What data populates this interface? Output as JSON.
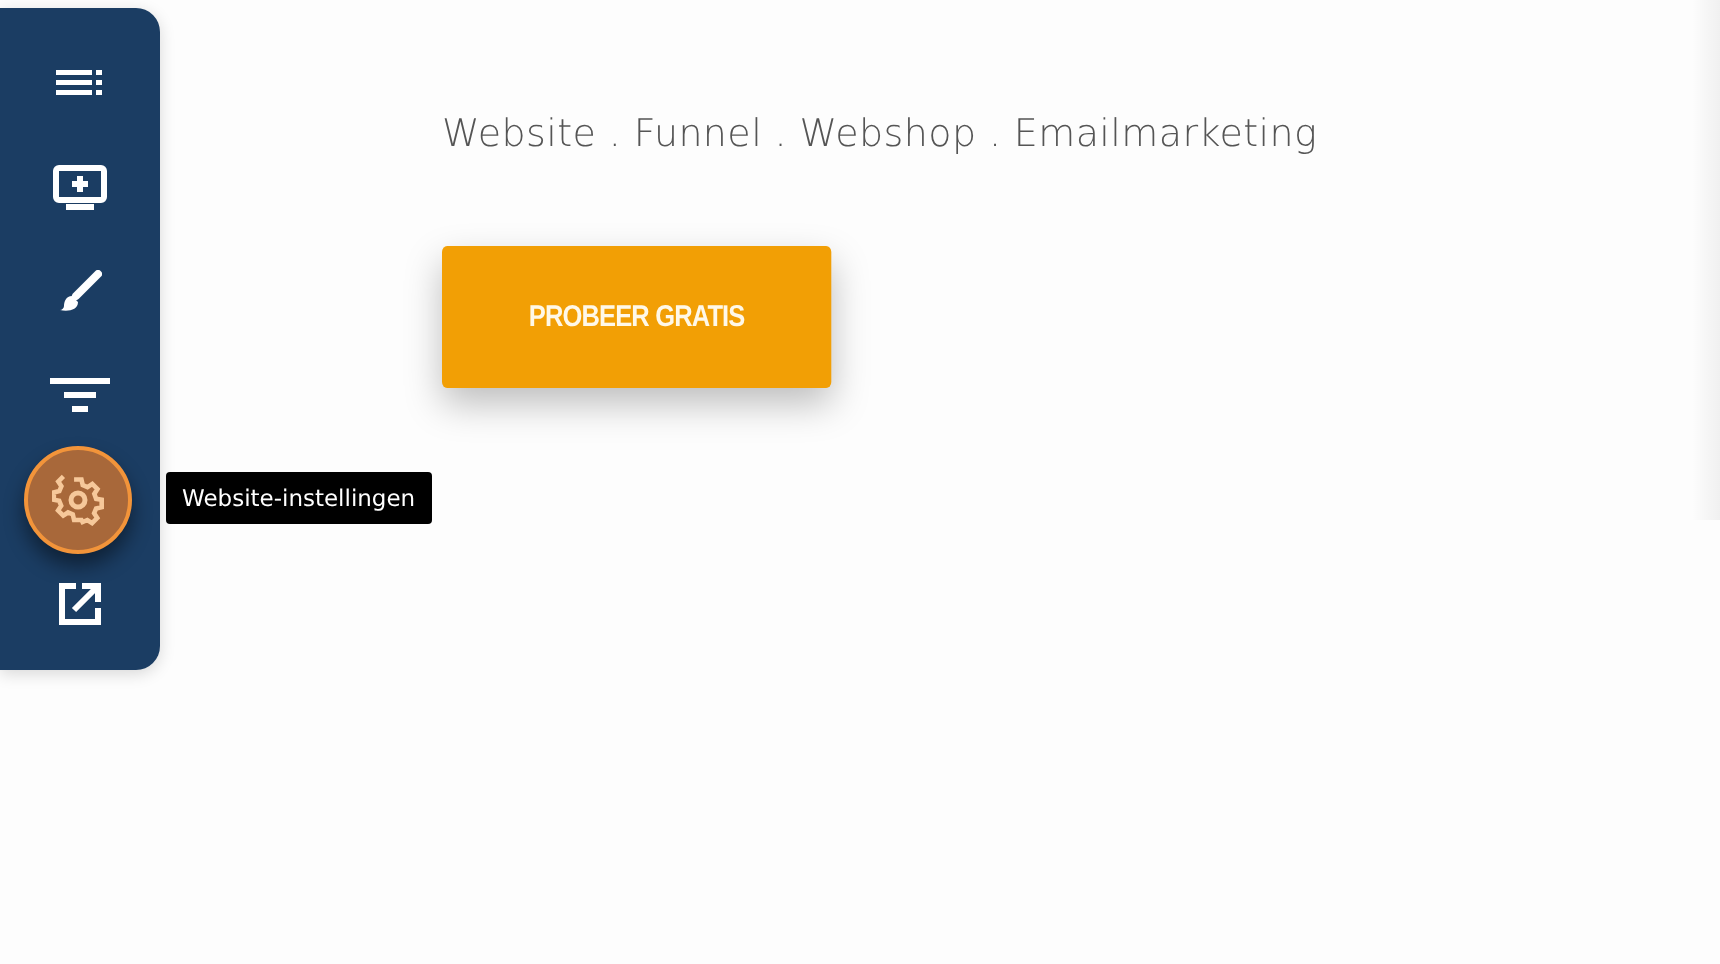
{
  "sidebar": {
    "items": [
      {
        "kind": "list",
        "selected": false
      },
      {
        "kind": "add-screen",
        "selected": false
      },
      {
        "kind": "brush",
        "selected": false
      },
      {
        "kind": "filter",
        "selected": false
      },
      {
        "kind": "gear",
        "selected": true
      },
      {
        "kind": "external",
        "selected": false
      }
    ],
    "tooltip": "Website-instellingen"
  },
  "hero": {
    "subtitle": "Website . Funnel . Webshop . Emailmarketing",
    "button": "PROBEER GRATIS"
  }
}
